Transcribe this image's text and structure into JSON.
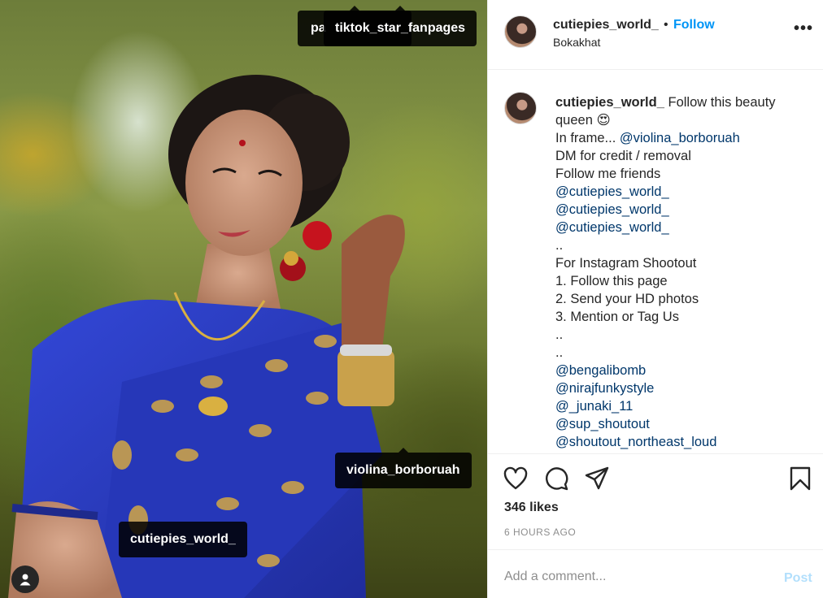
{
  "photo": {
    "tags": {
      "behind": "pa",
      "tiktok": "tiktok_star_fanpages",
      "violina": "violina_borboruah",
      "cutie": "cutiepies_world_"
    },
    "user_tag_icon": "person-icon"
  },
  "header": {
    "username": "cutiepies_world_",
    "dot": "•",
    "follow_label": "Follow",
    "location": "Bokakhat",
    "more_icon": "•••"
  },
  "caption": {
    "username": "cutiepies_world_",
    "first_line": "Follow this beauty",
    "second_line": "queen",
    "emoji": "😍",
    "in_frame_prefix": "In frame... ",
    "in_frame_mention": "@violina_borboruah",
    "lines_a": [
      "DM for credit / removal",
      "Follow me friends"
    ],
    "mentions_a": [
      "@cutiepies_world_",
      "@cutiepies_world_",
      "@cutiepies_world_"
    ],
    "lines_b": [
      "..",
      "For Instagram Shootout",
      "1. Follow this page",
      "2. Send your HD photos",
      "3. Mention or Tag Us",
      "..",
      ".."
    ],
    "mentions_b": [
      "@bengalibomb",
      "@nirajfunkystyle",
      "@_junaki_11",
      "@sup_shoutout",
      "@shoutout_northeast_loud"
    ]
  },
  "actions": {
    "icons": [
      "heart-icon",
      "comment-icon",
      "share-icon",
      "bookmark-icon"
    ],
    "likes": "346 likes",
    "time": "6 HOURS AGO"
  },
  "comment": {
    "placeholder": "Add a comment...",
    "post_label": "Post"
  },
  "colors": {
    "link": "#0095f6",
    "mention": "#00376b",
    "post_disabled": "#b2dffc",
    "saree": "#2b3ec9"
  }
}
